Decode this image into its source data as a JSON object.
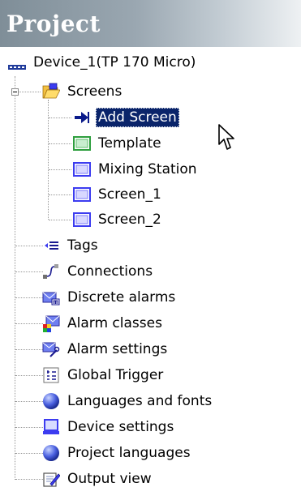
{
  "header": {
    "title": "Project"
  },
  "tree": {
    "root": {
      "label": "Device_1(TP 170 Micro)",
      "icon": "device-icon"
    },
    "screens": {
      "label": "Screens",
      "icon": "open-folder-icon",
      "expanded": true,
      "children": [
        {
          "label": "Add Screen",
          "icon": "add-screen-arrow-icon",
          "selected": true
        },
        {
          "label": "Template",
          "icon": "template-screen-icon"
        },
        {
          "label": "Mixing Station",
          "icon": "screen-icon"
        },
        {
          "label": "Screen_1",
          "icon": "screen-icon"
        },
        {
          "label": "Screen_2",
          "icon": "screen-icon"
        }
      ]
    },
    "items": [
      {
        "label": "Tags",
        "icon": "tags-icon"
      },
      {
        "label": "Connections",
        "icon": "connections-icon"
      },
      {
        "label": "Discrete alarms",
        "icon": "discrete-alarms-icon"
      },
      {
        "label": "Alarm classes",
        "icon": "alarm-classes-icon"
      },
      {
        "label": "Alarm settings",
        "icon": "alarm-settings-icon"
      },
      {
        "label": "Global Trigger",
        "icon": "global-trigger-icon"
      },
      {
        "label": "Languages and fonts",
        "icon": "globe-icon"
      },
      {
        "label": "Device settings",
        "icon": "device-settings-icon"
      },
      {
        "label": "Project languages",
        "icon": "globe-icon"
      },
      {
        "label": "Output view",
        "icon": "output-view-icon"
      }
    ]
  },
  "colors": {
    "selection_bg": "#0a246a",
    "selection_text": "#ffffff",
    "header_gradient_start": "#7f8e98",
    "screen_icon_blue": "#3c3cf0",
    "template_icon_green": "#2e9e3e"
  }
}
